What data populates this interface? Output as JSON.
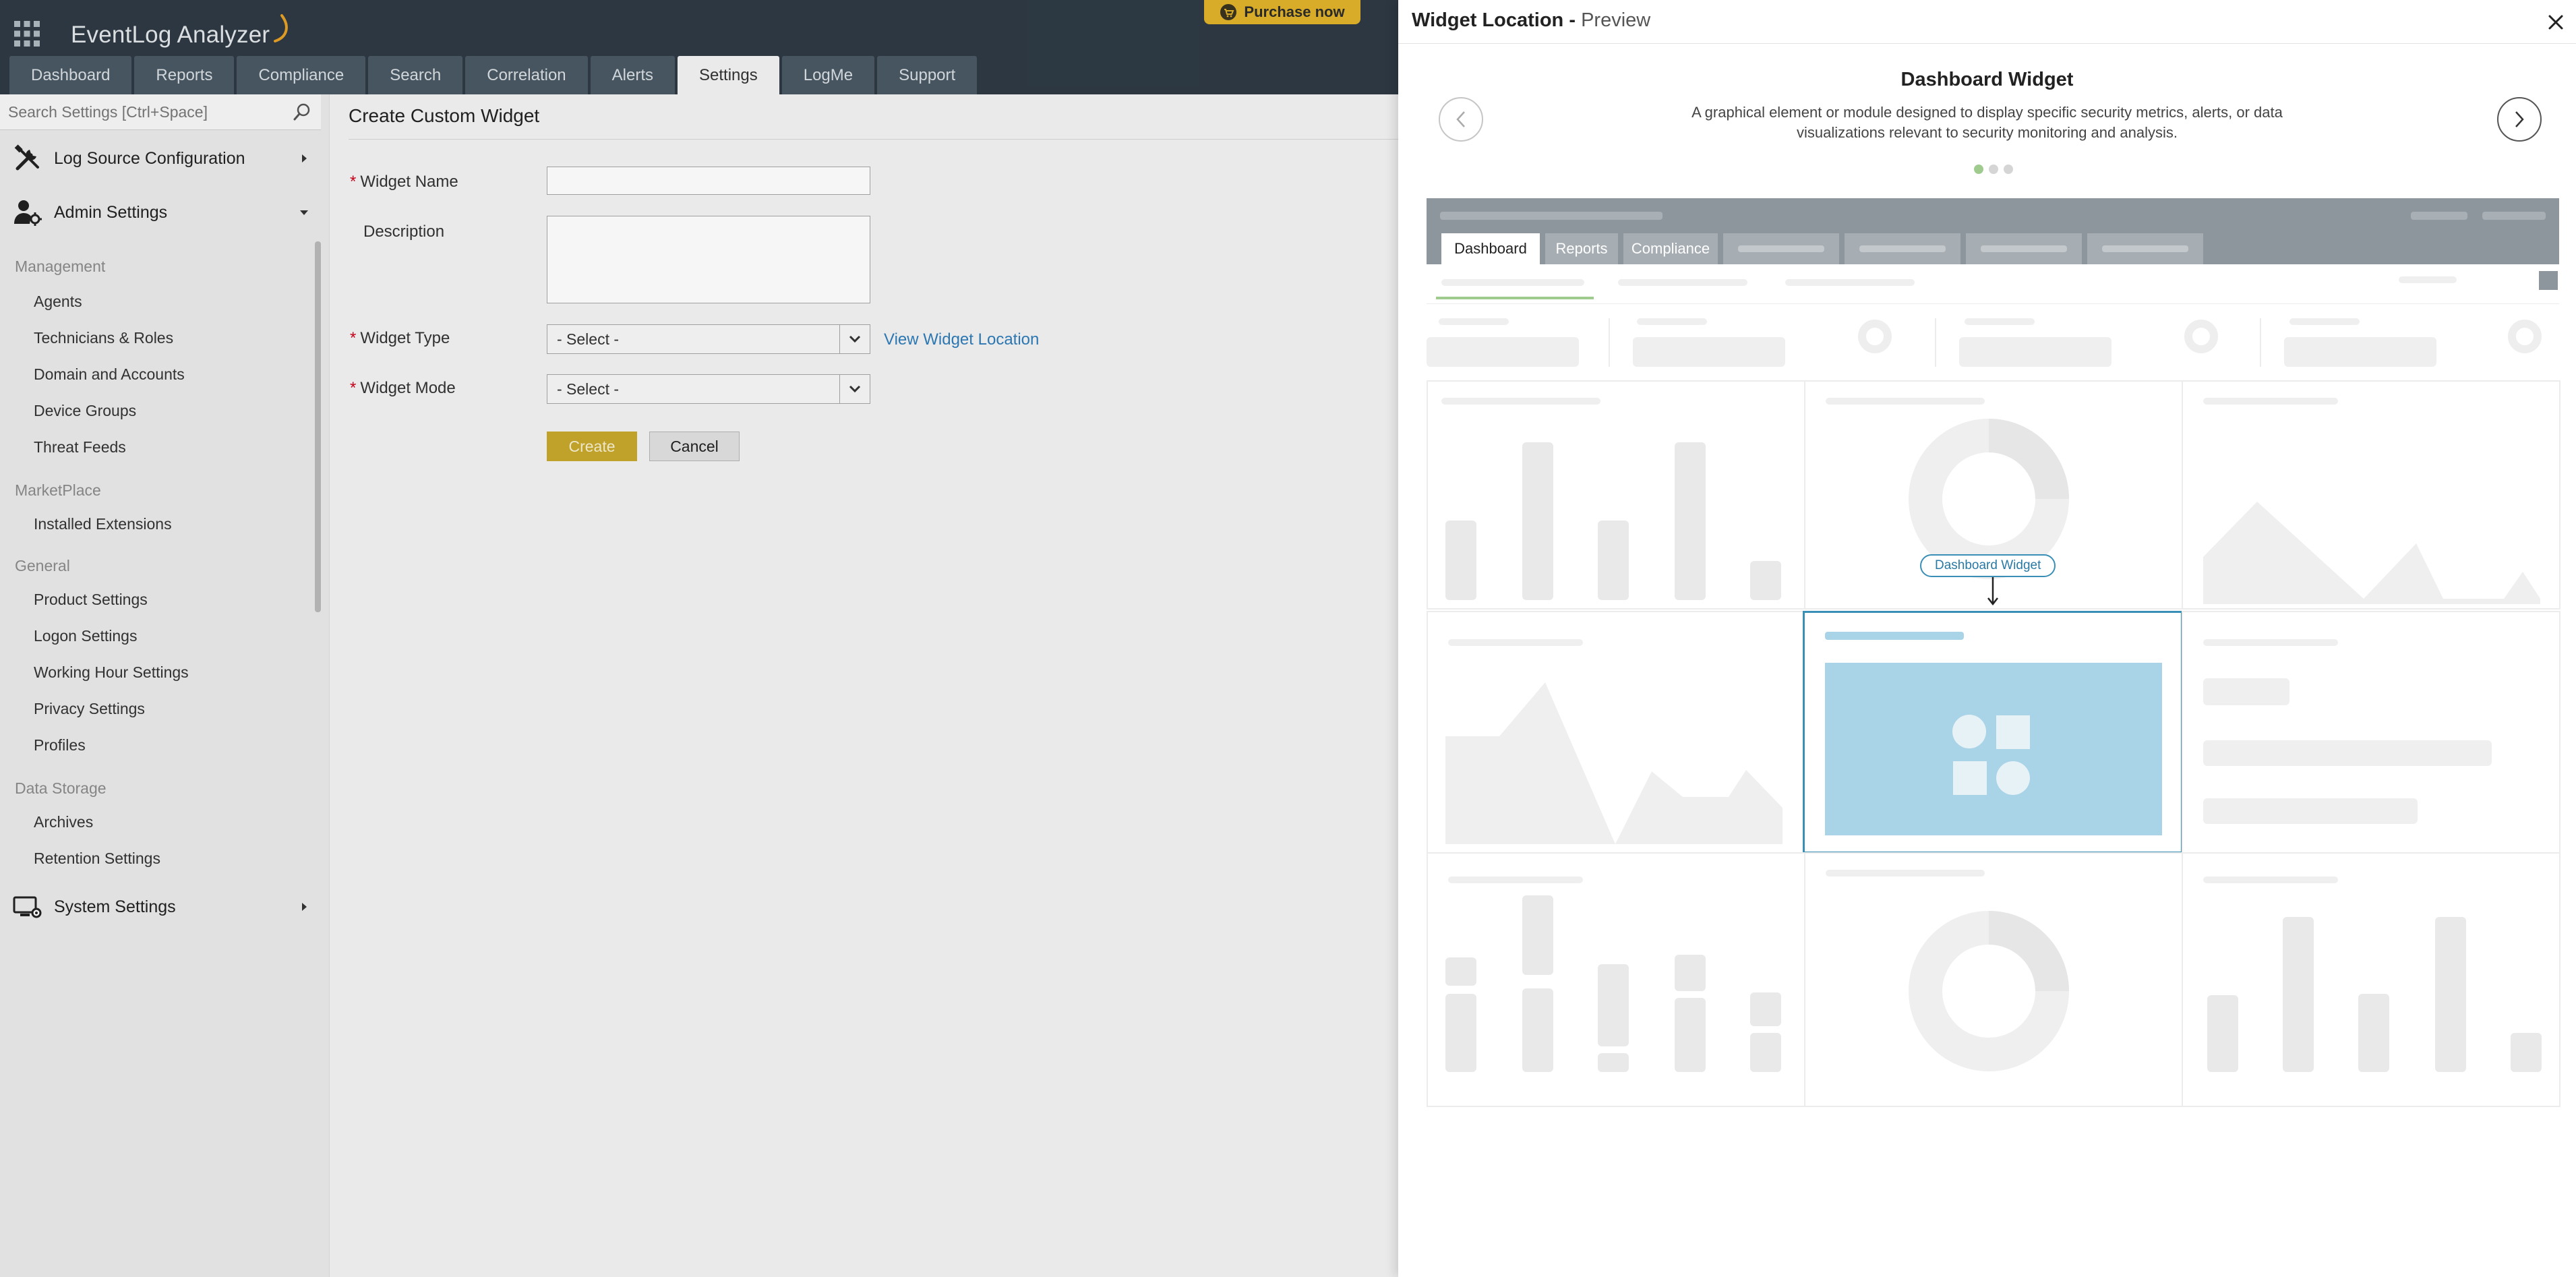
{
  "app": {
    "logo_text": "EventLog Analyzer",
    "purchase_label": "Purchase now",
    "tabs": [
      {
        "label": "Dashboard"
      },
      {
        "label": "Reports"
      },
      {
        "label": "Compliance"
      },
      {
        "label": "Search"
      },
      {
        "label": "Correlation"
      },
      {
        "label": "Alerts"
      },
      {
        "label": "Settings",
        "active": true
      },
      {
        "label": "LogMe"
      },
      {
        "label": "Support"
      }
    ]
  },
  "sidebar": {
    "search_placeholder": "Search Settings [Ctrl+Space]",
    "log_source_label": "Log Source Configuration",
    "admin_label": "Admin Settings",
    "system_label": "System Settings",
    "groups": {
      "management": "Management",
      "marketplace": "MarketPlace",
      "general": "General",
      "data_storage": "Data Storage"
    },
    "items": {
      "agents": "Agents",
      "technicians": "Technicians & Roles",
      "domain": "Domain and Accounts",
      "device_groups": "Device Groups",
      "threat_feeds": "Threat Feeds",
      "installed_extensions": "Installed Extensions",
      "product_settings": "Product Settings",
      "logon_settings": "Logon Settings",
      "working_hour": "Working Hour Settings",
      "privacy": "Privacy Settings",
      "profiles": "Profiles",
      "archives": "Archives",
      "retention": "Retention Settings"
    }
  },
  "form": {
    "title": "Create Custom Widget",
    "widget_name_label": "Widget Name",
    "widget_name_value": "",
    "description_label": "Description",
    "description_value": "",
    "widget_type_label": "Widget Type",
    "widget_type_value": "- Select -",
    "widget_mode_label": "Widget Mode",
    "widget_mode_value": "- Select -",
    "view_location_link": "View Widget Location",
    "create_label": "Create",
    "cancel_label": "Cancel",
    "required_mark": "*"
  },
  "drawer": {
    "title_bold": "Widget Location",
    "title_sep": " - ",
    "title_light": "Preview",
    "carousel_title": "Dashboard Widget",
    "carousel_desc": "A graphical element or module designed to display specific security metrics, alerts, or data visualizations relevant to security monitoring and analysis.",
    "dots": 3,
    "active_dot": 0,
    "preview_tabs": [
      "Dashboard",
      "Reports",
      "Compliance"
    ],
    "callout": "Dashboard Widget"
  },
  "colors": {
    "topbar": "#2e3a44",
    "tab": "#4a5964",
    "accent_create": "#c7a72b",
    "purchase": "#e0b32a",
    "highlight": "#3a8fb7",
    "highlight_fill": "#a9d3e6"
  }
}
